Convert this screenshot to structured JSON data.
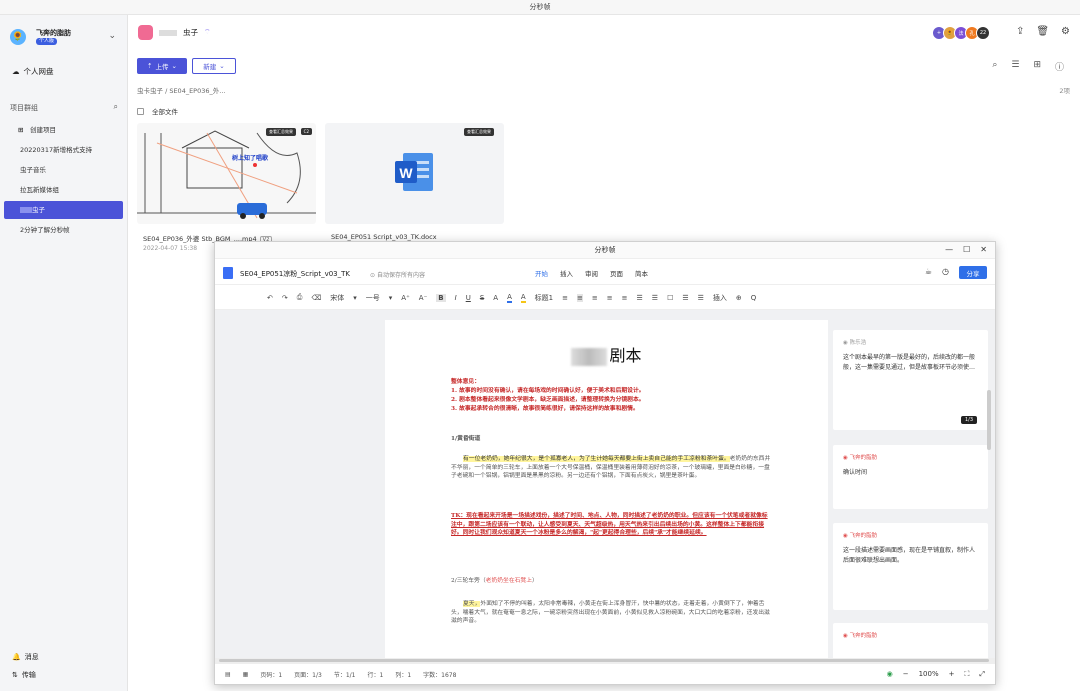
{
  "window": {
    "title": "分秒帧"
  },
  "sidebar": {
    "username": "飞奔的脂肪",
    "badge": "个人版",
    "personal": "个人网盘",
    "section_label": "项目群组",
    "create": "创建项目",
    "items": [
      "20220317新增格式支持",
      "虫子音乐",
      "拉瓦新媒体组",
      "虫子",
      "2分钟了解分秒帧"
    ],
    "messages": "消息",
    "transfer": "传输"
  },
  "header": {
    "project_name": "虫子",
    "team": [
      "法",
      "孔",
      "22"
    ]
  },
  "toolbar": {
    "upload": "上传",
    "new": "新建"
  },
  "breadcrumb": "虫卡虫子  /  SE04_EP036_外...",
  "file_count": "2项",
  "select_all": "全部文件",
  "files": [
    {
      "name": "SE04_EP036_外婆   Stb_BGM_....mp4",
      "version": "V2",
      "date": "2022-04-07 15:38",
      "tag": "查看汇总效果",
      "tag2": "C2"
    },
    {
      "name": "SE04_EP051     Script_v03_TK.docx",
      "tag": "查看汇总效果"
    }
  ],
  "thumb_caption": "树上知了唱歌",
  "doc": {
    "window_title": "分秒帧",
    "name": "SE04_EP051凉粉_Script_v03_TK",
    "autosave": "自动保存所有内容",
    "tabs": [
      "开始",
      "插入",
      "审阅",
      "页面",
      "简本"
    ],
    "share": "分享",
    "toolbar_items": [
      "↶",
      "↷",
      "⎙",
      "⌫",
      "宋体",
      "▾",
      "一号",
      "▾",
      "A⁺",
      "A⁻",
      "B",
      "I",
      "U",
      "S",
      "A",
      "A",
      "A",
      "标题1",
      "≡",
      "≡",
      "≡",
      "≡",
      "≡",
      "☰",
      "☰",
      "☐",
      "☰",
      "☰",
      "插入",
      "⊕",
      "Q"
    ],
    "page_title": "剧本",
    "overall": "整体意见：",
    "notes": [
      "1.   故事的时间没有确认，请在每场戏的时间确认好，便于美术和后期设计。",
      "2.   剧本整体看起来很像文学剧本，缺乏画面描述，请整理转换为分镜剧本。",
      "3.   故事起承转合的很清晰，故事很简练很好，请保持这样的故事和剧情。"
    ],
    "scene1": "1/黄昏街道",
    "para1_hl": "有一位老奶奶，她年纪很大，是个孤寡老人，为了生计她每天都要上街上卖自己能的手工凉粉和茶叶蛋。",
    "para1_rest": "老奶奶的东西并不华丽，一个简单的三轮车，上面放着一个大号保温桶，保温桶里装着用薄荷泡好的凉茶，一个玻璃罐，里面是白砂糖，一盘子老碗和一个铝锅，铝锅里面是黑黑的凉粉。另一边还有个铝锅，下面有点炭火，锅里是茶叶蛋。",
    "para2": "TK：现在看起来开场是一场描述戏份，描述了时间、地点、人物，同时描述了老奶奶的职业。但应该有一个伏笔或者就像标注中，跟第二场应该有一个联动，让人感受到夏天、天气超级热，用天气热来引出后续出场的小黄。这样整体上下都能衔接好。同时让我们观众知道夏天一个冰粉是多么的解渴，\"起\"更起得合理些，后续\"承\"才能继续延续。",
    "scene2": "2/三轮车旁（",
    "scene2_red": "老奶奶坐在石凳上",
    "scene2_end": "）",
    "para3_hl": "夏天，",
    "para3": "外面知了不停的叫着，太阳非常毒辣，小黄走在街上浑身冒汗，快中暑的状态，走着走着，小黄倒下了，伸着舌头，喘着大气，就在奄奄一息之际，一碗凉粉突然出现在小黄面前，小黄似见救人凉粉碗面，大口大口的吃着凉粉，还发出滋滋的声音。",
    "comments": [
      {
        "author": "陈乐浩",
        "text": "这个剧本最早的第一版是最好的，后续改的都一般般，这一集需要见通过，但是故事板环节必须使…"
      },
      {
        "author": "飞奔的脂肪",
        "text": "确认时间"
      },
      {
        "author": "飞奔的脂肪",
        "text": "这一段描述需要画面感，现在是平铺直叙，制作人后面很难联想出画面。"
      },
      {
        "author": "飞奔的脂肪",
        "text": ""
      }
    ],
    "pager": "1/3",
    "status": [
      "页码：1",
      "页面：1/3",
      "节：1/1",
      "行：1",
      "列：1",
      "字数：1678"
    ],
    "zoom": "100%"
  },
  "colors": {
    "accent": "#4b53d8",
    "doc_blue": "#2f6fe8",
    "note_red": "#c62828"
  }
}
